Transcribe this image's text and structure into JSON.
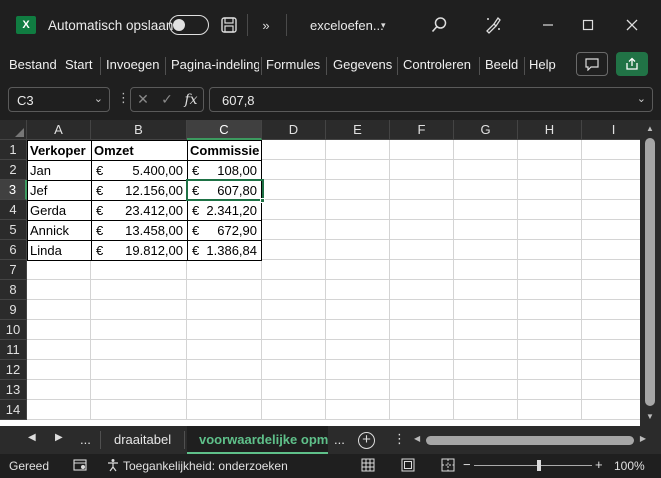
{
  "titlebar": {
    "app_icon_letter": "X",
    "autosave_label": "Automatisch opslaan",
    "autosave_state": "off",
    "more_label": "»",
    "doc_title": "exceloefen...",
    "doc_caret": "▾"
  },
  "ribbon": {
    "tabs": [
      "Bestand",
      "Start",
      "Invoegen",
      "Pagina-indeling",
      "Formules",
      "Gegevens",
      "Controleren",
      "Beeld",
      "Help"
    ],
    "share_color": "#217346"
  },
  "formula_bar": {
    "name_box": "C3",
    "dots": "⋮",
    "cancel": "✕",
    "enter": "✓",
    "fx": "fx",
    "value": "607,8"
  },
  "grid": {
    "columns": [
      "A",
      "B",
      "C",
      "D",
      "E",
      "F",
      "G",
      "H",
      "I"
    ],
    "active_column": "C",
    "rows": [
      "1",
      "2",
      "3",
      "4",
      "5",
      "6",
      "7",
      "8",
      "9",
      "10",
      "11",
      "12",
      "13",
      "14"
    ],
    "active_row": "3",
    "headers": {
      "a": "Verkoper",
      "b": "Omzet",
      "c": "Commissie"
    },
    "currency": "€",
    "data": [
      {
        "name": "Jan",
        "omzet": "5.400,00",
        "commissie": "108,00"
      },
      {
        "name": "Jef",
        "omzet": "12.156,00",
        "commissie": "607,80"
      },
      {
        "name": "Gerda",
        "omzet": "23.412,00",
        "commissie": "2.341,20"
      },
      {
        "name": "Annick",
        "omzet": "13.458,00",
        "commissie": "672,90"
      },
      {
        "name": "Linda",
        "omzet": "19.812,00",
        "commissie": "1.386,84"
      }
    ],
    "selection_color": "#1e7145"
  },
  "sheets": {
    "prev": "◀",
    "next": "▶",
    "ellipsis_left": "...",
    "tabs": [
      "draaitabel",
      "voorwaardelijke opm"
    ],
    "active_tab": "voorwaardelijke opm",
    "ellipsis_right": "...",
    "add": "+",
    "menu": "⋮"
  },
  "status": {
    "ready": "Gereed",
    "accessibility": "Toegankelijkheid: onderzoeken",
    "zoom_minus": "−",
    "zoom_plus": "+",
    "zoom": "100%"
  }
}
